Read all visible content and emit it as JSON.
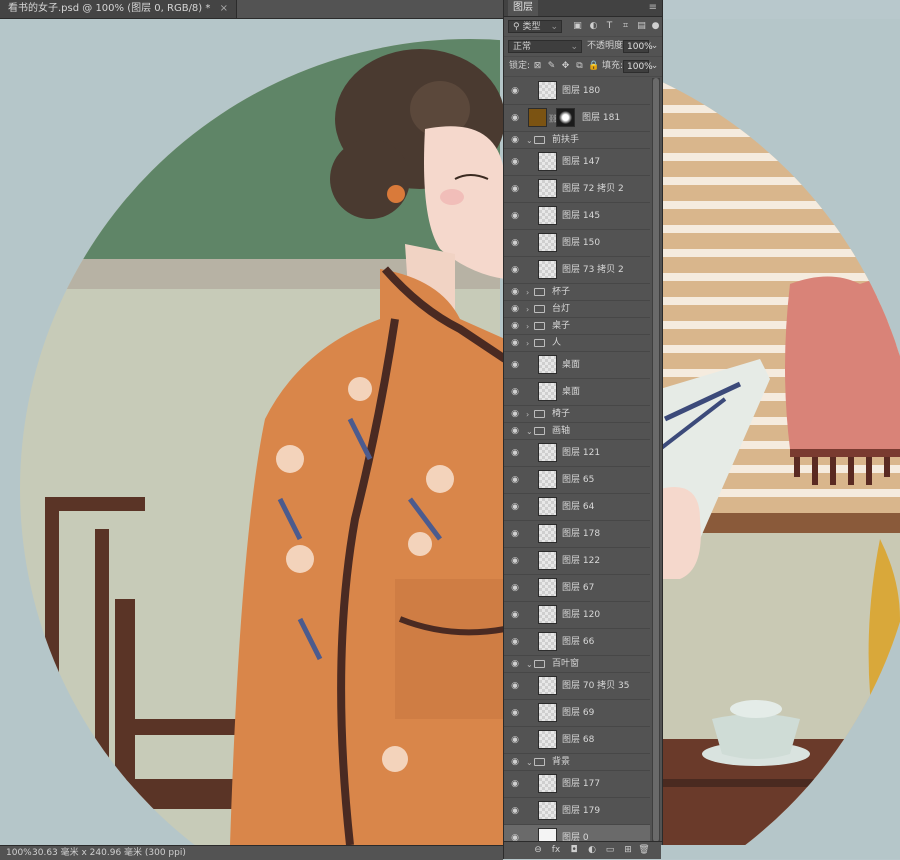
{
  "document": {
    "tab_title": "看书的女子.psd @ 100% (图层 0, RGB/8) *",
    "close_glyph": "×"
  },
  "layers_panel": {
    "title": "图层",
    "menu_glyph": "≡",
    "filter": {
      "label": "类型",
      "icons": [
        "image-filter-icon",
        "adjustment-filter-icon",
        "type-filter-icon",
        "shape-filter-icon",
        "smart-object-filter-icon"
      ]
    },
    "blend_mode": "正常",
    "opacity_label": "不透明度:",
    "opacity_value": "100%",
    "lock_label": "锁定:",
    "fill_label": "填充:",
    "fill_value": "100%",
    "layers": [
      {
        "kind": "layer",
        "name": "图层 180"
      },
      {
        "kind": "layer181",
        "name": "图层 181"
      },
      {
        "kind": "group",
        "name": "前扶手",
        "open": true
      },
      {
        "kind": "layer",
        "name": "图层 147",
        "indent": true
      },
      {
        "kind": "layer",
        "name": "图层 72 拷贝 2",
        "indent": true
      },
      {
        "kind": "layer",
        "name": "图层 145",
        "indent": true
      },
      {
        "kind": "layer",
        "name": "图层 150",
        "indent": true
      },
      {
        "kind": "layer",
        "name": "图层 73 拷贝 2",
        "indent": true
      },
      {
        "kind": "group",
        "name": "杯子",
        "open": false
      },
      {
        "kind": "group",
        "name": "台灯",
        "open": false
      },
      {
        "kind": "group",
        "name": "桌子",
        "open": false
      },
      {
        "kind": "group",
        "name": "人",
        "open": false
      },
      {
        "kind": "layer",
        "name": "桌面"
      },
      {
        "kind": "layer",
        "name": "桌面"
      },
      {
        "kind": "group",
        "name": "椅子",
        "open": false
      },
      {
        "kind": "group",
        "name": "画轴",
        "open": true
      },
      {
        "kind": "layer",
        "name": "图层 121",
        "indent": true
      },
      {
        "kind": "layer",
        "name": "图层 65",
        "indent": true
      },
      {
        "kind": "layer",
        "name": "图层 64",
        "indent": true
      },
      {
        "kind": "layer",
        "name": "图层 178",
        "indent": true
      },
      {
        "kind": "layer",
        "name": "图层 122",
        "indent": true
      },
      {
        "kind": "layer",
        "name": "图层 67",
        "indent": true
      },
      {
        "kind": "layer",
        "name": "图层 120",
        "indent": true
      },
      {
        "kind": "layer",
        "name": "图层 66",
        "indent": true
      },
      {
        "kind": "group",
        "name": "百叶窗",
        "open": true
      },
      {
        "kind": "layer",
        "name": "图层 70 拷贝 35",
        "indent": true
      },
      {
        "kind": "layer",
        "name": "图层 69",
        "indent": true
      },
      {
        "kind": "layer",
        "name": "图层 68",
        "indent": true
      },
      {
        "kind": "group",
        "name": "背景",
        "open": true
      },
      {
        "kind": "layer",
        "name": "图层 177",
        "indent": true
      },
      {
        "kind": "layer",
        "name": "图层 179",
        "indent": true
      },
      {
        "kind": "layer",
        "name": "图层 0",
        "indent": true,
        "selected": true
      }
    ],
    "footer_icons": [
      "link-layers-icon",
      "fx-icon",
      "add-mask-icon",
      "adjustment-layer-icon",
      "new-group-icon",
      "new-layer-icon",
      "delete-layer-icon"
    ],
    "footer_glyphs": [
      "⊖",
      "fx",
      "◘",
      "◐",
      "▭",
      "⊞",
      "🗑"
    ]
  },
  "status_bar": {
    "zoom": "100%",
    "doc_size": "30.63 毫米 x 240.96 毫米 (300 ppi)",
    "arrow": "›"
  },
  "colors": {
    "panel_bg": "#535353",
    "canvas_bg": "#b5c6c9",
    "wall_green": "#5e8464",
    "dress_orange": "#d9864a",
    "hair_brown": "#4a3a30",
    "blind_tan": "#d8b68c",
    "lamp_pink": "#d98378"
  }
}
